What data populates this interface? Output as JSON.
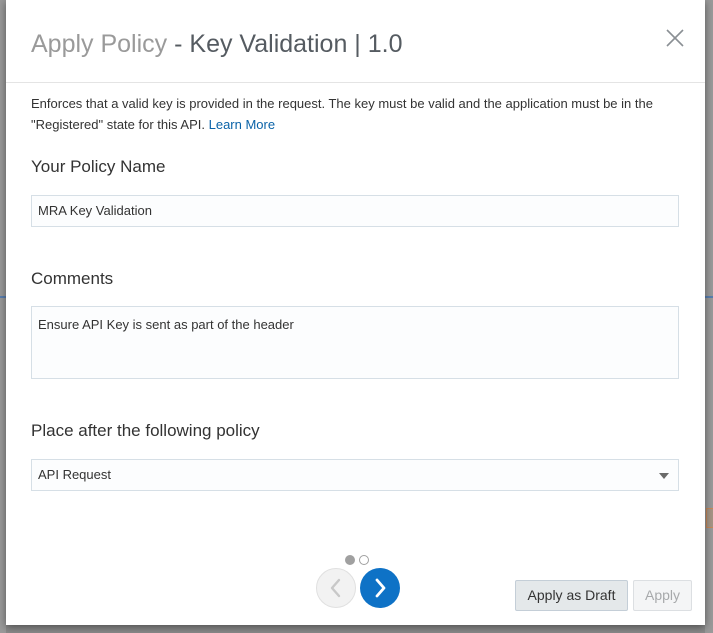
{
  "dialog": {
    "title_prefix": "Apply Policy",
    "title_main": " - Key Validation | 1.0",
    "description": "Enforces that a valid key is provided in the request. The key must be valid and the application must be in the \"Registered\" state for this API.",
    "learn_more": "Learn More",
    "close_icon": "close-icon"
  },
  "form": {
    "policy_name": {
      "label": "Your Policy Name",
      "value": "MRA Key Validation"
    },
    "comments": {
      "label": "Comments",
      "value": "Ensure API Key is sent as part of the header"
    },
    "place_after": {
      "label": "Place after the following policy",
      "selected": "API Request"
    }
  },
  "pager": {
    "current_page": 1,
    "total_pages": 2,
    "prev_icon": "chevron-left-icon",
    "next_icon": "chevron-right-icon"
  },
  "buttons": {
    "apply_draft": "Apply as Draft",
    "apply": "Apply"
  },
  "colors": {
    "accent": "#0e72c6",
    "link": "#0a63a8",
    "input_border": "#d6dfe6"
  }
}
